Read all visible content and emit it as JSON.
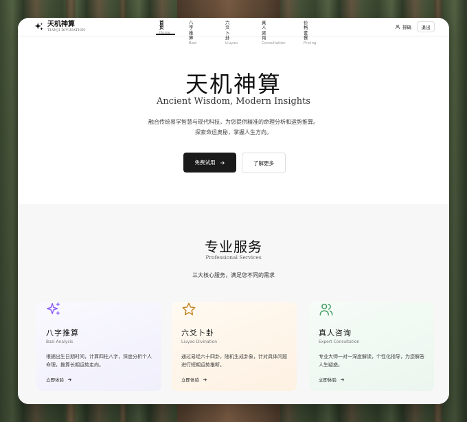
{
  "brand": {
    "name_cn": "天机神算",
    "name_en": "TIANJI DIVINATION"
  },
  "nav": {
    "tabs": [
      {
        "cn": "首页",
        "en": "Home"
      },
      {
        "cn": "八字推算",
        "en": "Bazi"
      },
      {
        "cn": "六爻卜卦",
        "en": "Liuyao"
      },
      {
        "cn": "真人咨询",
        "en": "Consultation"
      },
      {
        "cn": "价格套餐",
        "en": "Pricing"
      }
    ],
    "login_label": "掃碼",
    "logout_label": "退出"
  },
  "hero": {
    "title": "天机神算",
    "subtitle": "Ancient Wisdom, Modern Insights",
    "desc_line1": "融合传统易学智慧与现代科技，为您提供精准的命理分析和运势推算。",
    "desc_line2": "探索命运奥秘，掌握人生方向。",
    "primary_button": "免费试用",
    "secondary_button": "了解更多"
  },
  "services": {
    "title": "专业服务",
    "subtitle": "Professional Services",
    "desc": "三大核心服务，满足您不同的需求",
    "cards": [
      {
        "icon": "sparkles-icon",
        "title": "八字推算",
        "en": "Bazi Analysis",
        "text": "根据出生日期时间，计算四柱八字，深度分析个人命理，推算长期运势走向。",
        "link": "立即体验",
        "icon_color": "#8b5cf6"
      },
      {
        "icon": "star-icon",
        "title": "六爻卜卦",
        "en": "Liuyao Divination",
        "text": "通过易经六十四卦，随机生成卦象，针对具体问题进行短期运势推断。",
        "link": "立即体验",
        "icon_color": "#c2821f"
      },
      {
        "icon": "users-icon",
        "title": "真人咨询",
        "en": "Expert Consultation",
        "text": "专业大师一对一深度解读，个性化指导，为您解答人生疑惑。",
        "link": "立即体验",
        "icon_color": "#3f9b5e"
      }
    ]
  }
}
